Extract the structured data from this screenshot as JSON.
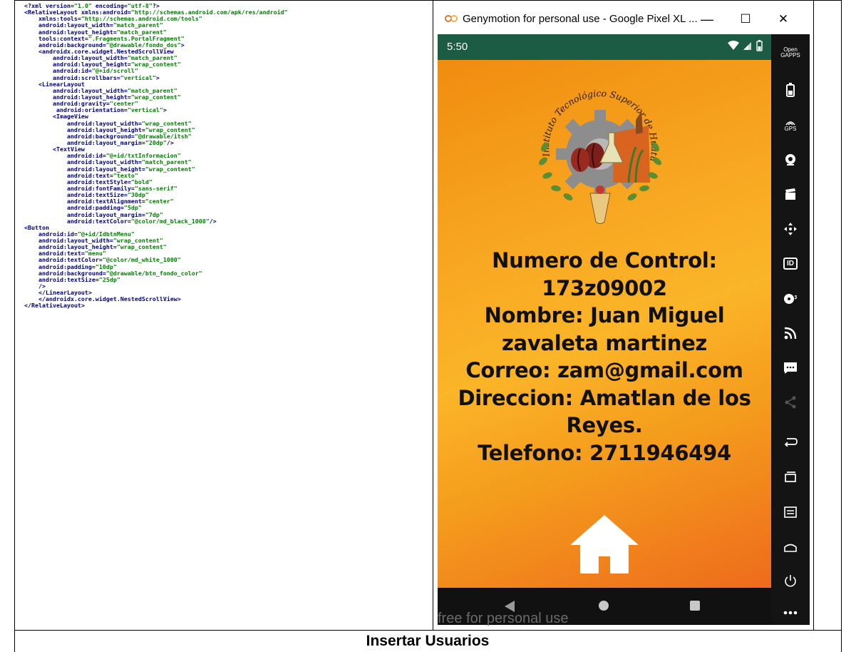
{
  "code_lines": [
    [
      [
        "punct",
        "<?"
      ],
      [
        "tag",
        "xml version="
      ],
      [
        "val",
        "\"1.0\""
      ],
      [
        "tag",
        " encoding="
      ],
      [
        "val",
        "\"utf-8\""
      ],
      [
        "punct",
        "?>"
      ]
    ],
    [
      [
        "punct",
        "<"
      ],
      [
        "tag",
        "RelativeLayout xmlns:android="
      ],
      [
        "val",
        "\"http://schemas.android.com/apk/res/android\""
      ]
    ],
    [
      [
        "tag",
        "    xmlns:tools="
      ],
      [
        "val",
        "\"http://schemas.android.com/tools\""
      ]
    ],
    [
      [
        "tag",
        "    android:layout_width="
      ],
      [
        "val",
        "\"match_parent\""
      ]
    ],
    [
      [
        "tag",
        "    android:layout_height="
      ],
      [
        "val",
        "\"match_parent\""
      ]
    ],
    [
      [
        "tag",
        "    tools:context="
      ],
      [
        "val",
        "\".Fragments.PortalFragment\""
      ]
    ],
    [
      [
        "tag",
        "    android:background="
      ],
      [
        "val",
        "\"@drawable/fondo_dos\""
      ],
      [
        "punct",
        ">"
      ]
    ],
    [
      [
        "punct",
        "    <"
      ],
      [
        "tag",
        "androidx.core.widget.NestedScrollView"
      ]
    ],
    [
      [
        "tag",
        "        android:layout_width="
      ],
      [
        "val",
        "\"match_parent\""
      ]
    ],
    [
      [
        "tag",
        "        android:layout_height="
      ],
      [
        "val",
        "\"wrap_content\""
      ]
    ],
    [
      [
        "tag",
        "        android:id="
      ],
      [
        "val",
        "\"@+id/scroll\""
      ]
    ],
    [
      [
        "tag",
        "        android:scrollbars="
      ],
      [
        "val",
        "\"vertical\""
      ],
      [
        "punct",
        ">"
      ]
    ],
    [
      [
        "punct",
        "    <"
      ],
      [
        "tag",
        "LinearLayout"
      ]
    ],
    [
      [
        "tag",
        "        android:layout_width="
      ],
      [
        "val",
        "\"match_parent\""
      ]
    ],
    [
      [
        "tag",
        "        android:layout_height="
      ],
      [
        "val",
        "\"wrap_content\""
      ]
    ],
    [
      [
        "tag",
        "        android:gravity="
      ],
      [
        "val",
        "\"center\""
      ]
    ],
    [
      [
        "tag",
        "         android:orientation="
      ],
      [
        "val",
        "\"vertical\""
      ],
      [
        "punct",
        ">"
      ]
    ],
    [
      [
        "punct",
        "        <"
      ],
      [
        "tag",
        "ImageView"
      ]
    ],
    [
      [
        "tag",
        "            android:layout_width="
      ],
      [
        "val",
        "\"wrap_content\""
      ]
    ],
    [
      [
        "tag",
        "            android:layout_height="
      ],
      [
        "val",
        "\"wrap_content\""
      ]
    ],
    [
      [
        "tag",
        "            android:background="
      ],
      [
        "val",
        "\"@drawable/itsh\""
      ]
    ],
    [
      [
        "tag",
        "            android:layout_margin="
      ],
      [
        "val",
        "\"20dp\""
      ],
      [
        "punct",
        "/>"
      ]
    ],
    [
      [
        "punct",
        "        <"
      ],
      [
        "tag",
        "TextView"
      ]
    ],
    [
      [
        "tag",
        "            android:id="
      ],
      [
        "val",
        "\"@+id/txtInformacion\""
      ]
    ],
    [
      [
        "tag",
        "            android:layout_width="
      ],
      [
        "val",
        "\"match_parent\""
      ]
    ],
    [
      [
        "tag",
        "            android:layout_height="
      ],
      [
        "val",
        "\"wrap_content\""
      ]
    ],
    [
      [
        "tag",
        "            android:text="
      ],
      [
        "val",
        "\"texto\""
      ]
    ],
    [
      [
        "tag",
        "            android:textStyle="
      ],
      [
        "val",
        "\"bold\""
      ]
    ],
    [
      [
        "tag",
        "            android:fontFamily="
      ],
      [
        "val",
        "\"sans-serif\""
      ]
    ],
    [
      [
        "tag",
        "            android:textSize="
      ],
      [
        "val",
        "\"30dp\""
      ]
    ],
    [
      [
        "tag",
        "            android:textAlignment="
      ],
      [
        "val",
        "\"center\""
      ]
    ],
    [
      [
        "tag",
        "            android:padding="
      ],
      [
        "val",
        "\"5dp\""
      ]
    ],
    [
      [
        "tag",
        "            android:layout_margin="
      ],
      [
        "val",
        "\"7dp\""
      ]
    ],
    [
      [
        "tag",
        "            android:textColor="
      ],
      [
        "val",
        "\"@color/md_black_1000\""
      ],
      [
        "punct",
        "/>"
      ]
    ],
    [
      [
        "punct",
        "<"
      ],
      [
        "tag",
        "Button"
      ]
    ],
    [
      [
        "tag",
        "    android:id="
      ],
      [
        "val",
        "\"@+id/IdbtnMenu\""
      ]
    ],
    [
      [
        "tag",
        "    android:layout_width="
      ],
      [
        "val",
        "\"wrap_content\""
      ]
    ],
    [
      [
        "tag",
        "    android:layout_height="
      ],
      [
        "val",
        "\"wrap_content\""
      ]
    ],
    [
      [
        "tag",
        "    android:text="
      ],
      [
        "val",
        "\"menu\""
      ]
    ],
    [
      [
        "tag",
        "    android:textColor="
      ],
      [
        "val",
        "\"@color/md_white_1000\""
      ]
    ],
    [
      [
        "tag",
        "    android:padding="
      ],
      [
        "val",
        "\"10dp\""
      ]
    ],
    [
      [
        "tag",
        "    android:background="
      ],
      [
        "val",
        "\"@drawable/btn_fondo_color\""
      ]
    ],
    [
      [
        "tag",
        "    android:textSize="
      ],
      [
        "val",
        "\"25dp\""
      ]
    ],
    [
      [
        "punct",
        "    />"
      ]
    ],
    [
      [
        "punct",
        "    </"
      ],
      [
        "tag",
        "LinearLayout"
      ],
      [
        "punct",
        ">"
      ]
    ],
    [
      [
        "punct",
        "    </"
      ],
      [
        "tag",
        "androidx.core.widget.NestedScrollView"
      ],
      [
        "punct",
        ">"
      ]
    ],
    [
      [
        "punct",
        "</"
      ],
      [
        "tag",
        "RelativeLayout"
      ],
      [
        "punct",
        ">"
      ]
    ]
  ],
  "window": {
    "title": "Genymotion for personal use - Google Pixel XL ...",
    "minimize": "—",
    "maximize": "☐",
    "close": "✕"
  },
  "statusbar": {
    "time": "5:50"
  },
  "logo": {
    "arc_text": "Instituto Tecnológico Superior de Huatusco"
  },
  "info_lines": [
    "Numero de Control:",
    "173z09002",
    "Nombre: Juan Miguel",
    "zavaleta martinez",
    "Correo: zam@gmail.com",
    "Direccion: Amatlan de los",
    "Reyes.",
    "Telefono: 2711946494"
  ],
  "watermark": "free for personal use",
  "sidebar": {
    "open_gapps": "Open GAPPS",
    "gps": "GPS",
    "id": "ID"
  },
  "footer": {
    "title": "Insertar Usuarios"
  },
  "colors": {
    "code_tag": "#000080",
    "code_value": "#008000",
    "statusbar": "#1c5c45",
    "sidebar": "#141414",
    "gradient_top": "#f08c10",
    "gradient_mid": "#fbb528",
    "gradient_bottom": "#ee6b1c"
  }
}
